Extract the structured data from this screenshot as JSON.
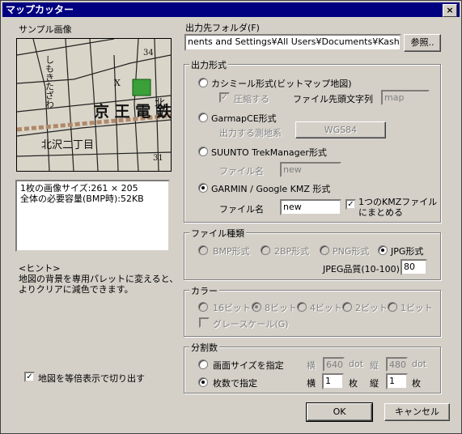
{
  "window": {
    "title": "マップカッター",
    "close_glyph": "×"
  },
  "sample": {
    "label": "サンプル画像",
    "map_texts": {
      "big": "京 王 電 鉄",
      "north": "北",
      "street": "北沢二丁目",
      "vert": "しもきたざわ",
      "num1": "34",
      "num2": "31",
      "x": "X"
    },
    "info_line1": "1枚の画像サイズ:261 × 205",
    "info_line2": "全体の必要容量(BMP時):52KB"
  },
  "hint": {
    "title": "<ヒント>",
    "line1": "地図の背景を専用パレットに変えると、",
    "line2": "よりクリアに減色できます。"
  },
  "crop_checkbox": {
    "label": "地図を等倍表示で切り出す",
    "checked": true
  },
  "output_folder": {
    "label": "出力先フォルダ(F)",
    "value": "nents and Settings¥All Users¥Documents¥Kashmir¥",
    "browse_label": "参照.."
  },
  "output_format": {
    "title": "出力形式",
    "bitmap": {
      "label": "カシミール形式(ビットマップ地図)",
      "compress_label": "圧縮する",
      "prefix_label": "ファイル先頭文字列",
      "prefix_value": "map"
    },
    "garmapce": {
      "label": "GarmapCE形式",
      "datum_label": "出力する測地系",
      "datum_button": "WGS84"
    },
    "suunto": {
      "label": "SUUNTO TrekManager形式",
      "filename_label": "ファイル名",
      "filename_value": "new"
    },
    "garmin": {
      "label": "GARMIN / Google KMZ 形式",
      "filename_label": "ファイル名",
      "filename_value": "new",
      "combine_line1": "1つのKMZファイル",
      "combine_line2": "にまとめる",
      "combine_checked": true
    },
    "selected": "garmin"
  },
  "file_type": {
    "title": "ファイル種類",
    "options": [
      "BMP形式",
      "2BP形式",
      "PNG形式",
      "JPG形式"
    ],
    "selected": "JPG形式",
    "quality_label": "JPEG品質(10-100)",
    "quality_value": "80"
  },
  "color": {
    "title": "カラー",
    "options": [
      "16ビット",
      "8ビット",
      "4ビット",
      "2ビット",
      "1ビット"
    ],
    "selected": "8ビット",
    "grayscale_label": "グレースケール(G)"
  },
  "division": {
    "title": "分割数",
    "by_size_label": "画面サイズを指定",
    "by_count_label": "枚数で指定",
    "selected": "by_count",
    "size_w_label": "横",
    "size_w_value": "640",
    "size_w_unit": "dot",
    "size_h_label": "縦",
    "size_h_value": "480",
    "size_h_unit": "dot",
    "count_w_label": "横",
    "count_w_value": "1",
    "count_w_unit": "枚",
    "count_h_label": "縦",
    "count_h_value": "1",
    "count_h_unit": "枚"
  },
  "buttons": {
    "ok": "OK",
    "cancel": "キャンセル"
  }
}
